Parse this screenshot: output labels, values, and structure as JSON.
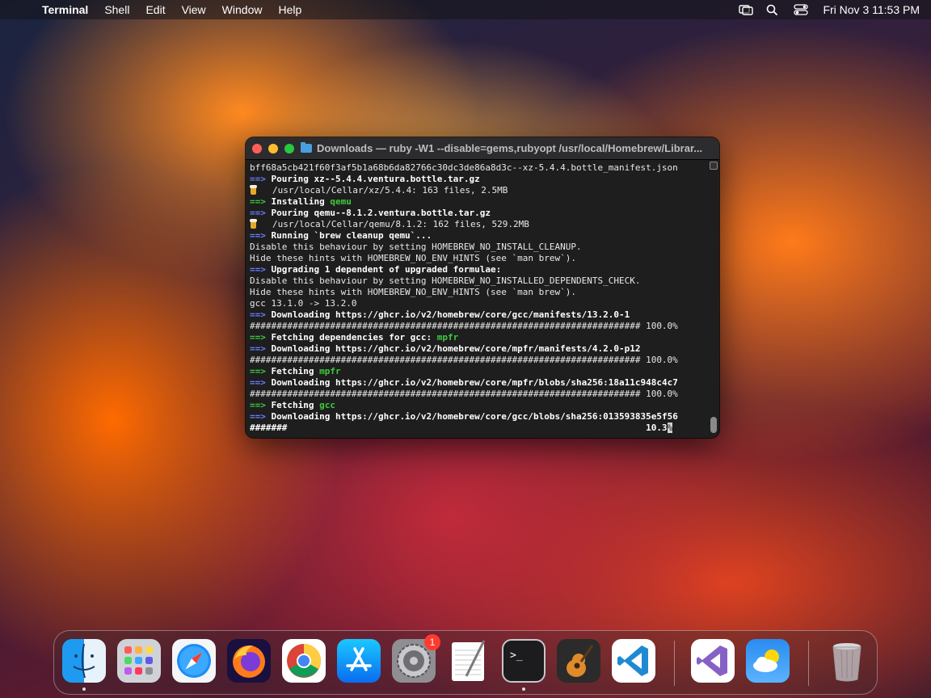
{
  "menubar": {
    "app_name": "Terminal",
    "items": [
      "Shell",
      "Edit",
      "View",
      "Window",
      "Help"
    ],
    "clock": "Fri Nov 3  11:53 PM"
  },
  "window": {
    "title": "Downloads — ruby -W1 --disable=gems,rubyopt /usr/local/Homebrew/Librar..."
  },
  "terminal": {
    "lines": [
      {
        "type": "plain",
        "text": "bff68a5cb421f60f3af5b1a68b6da82766c30dc3de86a8d3c--xz-5.4.4.bottle_manifest.json"
      },
      {
        "type": "blue",
        "prefix": "==>",
        "text": " Pouring xz--5.4.4.ventura.bottle.tar.gz"
      },
      {
        "type": "beer",
        "text": "/usr/local/Cellar/xz/5.4.4: 163 files, 2.5MB"
      },
      {
        "type": "green",
        "prefix": "==>",
        "text": " Installing ",
        "highlight": "qemu"
      },
      {
        "type": "blue",
        "prefix": "==>",
        "text": " Pouring qemu--8.1.2.ventura.bottle.tar.gz"
      },
      {
        "type": "beer",
        "text": "/usr/local/Cellar/qemu/8.1.2: 162 files, 529.2MB"
      },
      {
        "type": "blue",
        "prefix": "==>",
        "text": " Running `brew cleanup qemu`..."
      },
      {
        "type": "plain",
        "text": "Disable this behaviour by setting HOMEBREW_NO_INSTALL_CLEANUP."
      },
      {
        "type": "plain",
        "text": "Hide these hints with HOMEBREW_NO_ENV_HINTS (see `man brew`)."
      },
      {
        "type": "blue",
        "prefix": "==>",
        "text": " Upgrading 1 dependent of upgraded formulae:"
      },
      {
        "type": "plain",
        "text": "Disable this behaviour by setting HOMEBREW_NO_INSTALLED_DEPENDENTS_CHECK."
      },
      {
        "type": "plain",
        "text": "Hide these hints with HOMEBREW_NO_ENV_HINTS (see `man brew`)."
      },
      {
        "type": "plain",
        "text": "gcc 13.1.0 -> 13.2.0"
      },
      {
        "type": "blue",
        "prefix": "==>",
        "text": " Downloading https://ghcr.io/v2/homebrew/core/gcc/manifests/13.2.0-1"
      },
      {
        "type": "plain",
        "text": "######################################################################### 100.0%"
      },
      {
        "type": "green",
        "prefix": "==>",
        "text": " Fetching dependencies for gcc: ",
        "highlight": "mpfr"
      },
      {
        "type": "blue",
        "prefix": "==>",
        "text": " Downloading https://ghcr.io/v2/homebrew/core/mpfr/manifests/4.2.0-p12"
      },
      {
        "type": "plain",
        "text": "######################################################################### 100.0%"
      },
      {
        "type": "green",
        "prefix": "==>",
        "text": " Fetching ",
        "highlight": "mpfr"
      },
      {
        "type": "blue",
        "prefix": "==>",
        "text": " Downloading https://ghcr.io/v2/homebrew/core/mpfr/blobs/sha256:18a11c948c4c7"
      },
      {
        "type": "plain",
        "text": "######################################################################### 100.0%"
      },
      {
        "type": "green",
        "prefix": "==>",
        "text": " Fetching ",
        "highlight": "gcc"
      },
      {
        "type": "blue",
        "prefix": "==>",
        "text": " Downloading https://ghcr.io/v2/homebrew/core/gcc/blobs/sha256:013593835e5f56"
      },
      {
        "type": "progress",
        "text": "#######                                                                   10.3",
        "cursor": "%"
      }
    ]
  },
  "dock": {
    "items": [
      {
        "name": "finder",
        "running": true
      },
      {
        "name": "launchpad",
        "running": false
      },
      {
        "name": "safari",
        "running": false
      },
      {
        "name": "firefox",
        "running": false
      },
      {
        "name": "chrome",
        "running": false
      },
      {
        "name": "app-store",
        "running": false
      },
      {
        "name": "system-settings",
        "running": false,
        "badge": "1"
      },
      {
        "name": "textedit",
        "running": false
      },
      {
        "name": "terminal",
        "running": true
      },
      {
        "name": "garageband",
        "running": false
      },
      {
        "name": "vscode",
        "running": false
      },
      {
        "name": "visual-studio",
        "running": false
      },
      {
        "name": "weather",
        "running": false
      },
      {
        "name": "trash",
        "running": false
      }
    ]
  }
}
